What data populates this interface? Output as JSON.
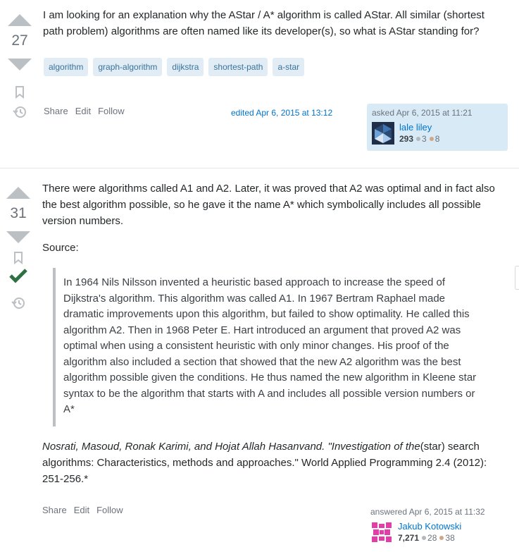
{
  "question": {
    "votes": "27",
    "text": "I am looking for an explanation why the AStar / A* algorithm is called AStar. All similar (shortest path problem) algorithms are often named like its developer(s), so what is AStar standing for?",
    "tags": [
      "algorithm",
      "graph-algorithm",
      "dijkstra",
      "shortest-path",
      "a-star"
    ],
    "menu": {
      "share": "Share",
      "edit": "Edit",
      "follow": "Follow"
    },
    "edited": "edited Apr 6, 2015 at 13:12",
    "asked": "asked Apr 6, 2015 at 11:21",
    "user": {
      "name": "lale liley",
      "rep": "293",
      "silver": "3",
      "bronze": "8"
    }
  },
  "answer": {
    "votes": "31",
    "accepted": true,
    "intro": "There were algorithms called A1 and A2. Later, it was proved that A2 was optimal and in fact also the best algorithm possible, so he gave it the name A* which symbolically includes all possible version numbers.",
    "source_label": "Source:",
    "quote": "In 1964 Nils Nilsson invented a heuristic based approach to increase the speed of Dijkstra's algorithm. This algorithm was called A1. In 1967 Bertram Raphael made dramatic improvements upon this algorithm, but failed to show optimality. He called this algorithm A2. Then in 1968 Peter E. Hart introduced an argument that proved A2 was optimal when using a consistent heuristic with only minor changes. His proof of the algorithm also included a section that showed that the new A2 algorithm was the best algorithm possible given the conditions. He thus named the new algorithm in Kleene star syntax to be the algorithm that starts with A and includes all possible version numbers or A*",
    "citation_italic": "Nosrati, Masoud, Ronak Karimi, and Hojat Allah Hasanvand. \"Investigation of the",
    "citation_rest": "(star) search algorithms: Characteristics, methods and approaches.\" World Applied Programming 2.4 (2012): 251-256.*",
    "menu": {
      "share": "Share",
      "edit": "Edit",
      "follow": "Follow"
    },
    "answered": "answered Apr 6, 2015 at 11:32",
    "user": {
      "name": "Jakub Kotowski",
      "rep": "7,271",
      "silver": "28",
      "bronze": "38"
    }
  },
  "colors": {
    "link": "#0074cc",
    "tag_bg": "#e1ecf4",
    "tag_text": "#39739d",
    "card_bg": "#d9eaf7",
    "accepted": "#2f6f44",
    "silver": "#b4b8bc",
    "bronze": "#d1a684"
  }
}
